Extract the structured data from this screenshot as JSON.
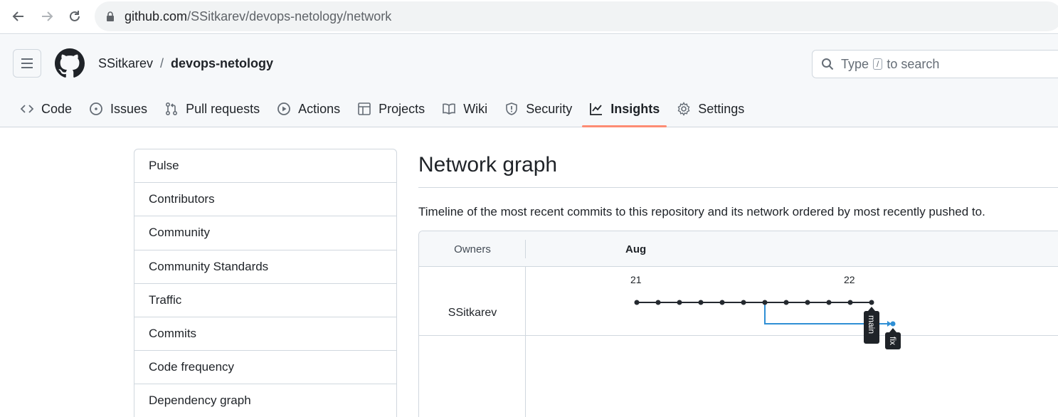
{
  "browser": {
    "url_domain": "github.com",
    "url_path": "/SSitkarev/devops-netology/network"
  },
  "header": {
    "owner": "SSitkarev",
    "separator": "/",
    "repo": "devops-netology",
    "search_prefix": "Type",
    "search_key": "/",
    "search_suffix": "to search"
  },
  "tabs": [
    {
      "label": "Code",
      "icon": "code-icon"
    },
    {
      "label": "Issues",
      "icon": "issue-icon"
    },
    {
      "label": "Pull requests",
      "icon": "pull-request-icon"
    },
    {
      "label": "Actions",
      "icon": "play-icon"
    },
    {
      "label": "Projects",
      "icon": "table-icon"
    },
    {
      "label": "Wiki",
      "icon": "book-icon"
    },
    {
      "label": "Security",
      "icon": "shield-icon"
    },
    {
      "label": "Insights",
      "icon": "graph-icon",
      "active": true
    },
    {
      "label": "Settings",
      "icon": "gear-icon"
    }
  ],
  "sidebar": {
    "items": [
      {
        "label": "Pulse"
      },
      {
        "label": "Contributors"
      },
      {
        "label": "Community"
      },
      {
        "label": "Community Standards"
      },
      {
        "label": "Traffic"
      },
      {
        "label": "Commits"
      },
      {
        "label": "Code frequency"
      },
      {
        "label": "Dependency graph"
      }
    ]
  },
  "main": {
    "title": "Network graph",
    "description": "Timeline of the most recent commits to this repository and its network ordered by most recently pushed to."
  },
  "network": {
    "owners_header": "Owners",
    "month": "Aug",
    "days": [
      "21",
      "22"
    ],
    "owner": "SSitkarev",
    "branches": [
      {
        "name": "main",
        "color": "#24292f",
        "commits": 12
      },
      {
        "name": "fix",
        "color": "#2f8fd5",
        "commits": 1,
        "forks_from_commit": 7
      }
    ]
  },
  "colors": {
    "accent_underline": "#fd8c73",
    "border": "#d0d7de",
    "header_bg": "#f6f8fa"
  }
}
